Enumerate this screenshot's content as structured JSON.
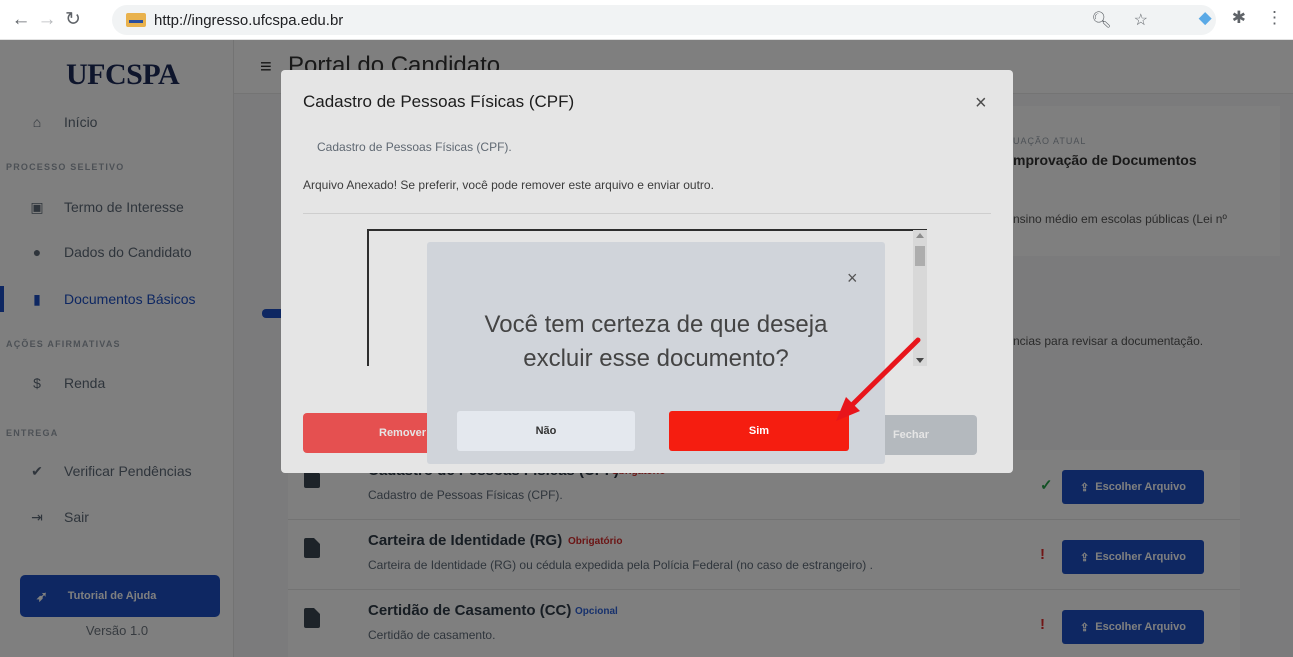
{
  "browser": {
    "url": "http://ingresso.ufcspa.edu.br"
  },
  "sidebar": {
    "logo": "UFCSPA",
    "items": [
      {
        "label": "Início",
        "icon": "home-icon"
      },
      {
        "label": "Termo de Interesse",
        "icon": "print-icon"
      },
      {
        "label": "Dados do Candidato",
        "icon": "user-icon"
      },
      {
        "label": "Documentos Básicos",
        "icon": "document-icon"
      },
      {
        "label": "Renda",
        "icon": "dollar-icon"
      },
      {
        "label": "Verificar Pendências",
        "icon": "check-icon"
      },
      {
        "label": "Sair",
        "icon": "logout-icon"
      }
    ],
    "sections": [
      "PROCESSO SELETIVO",
      "AÇÕES AFIRMATIVAS",
      "ENTREGA"
    ],
    "help_button": "Tutorial de Ajuda",
    "version": "Versão 1.0"
  },
  "header": {
    "title": "Portal do Candidato"
  },
  "status": {
    "label": "UAÇÃO ATUAL",
    "value": "mprovação de Documentos",
    "description": "nsino médio em escolas públicas (Lei nº",
    "review_note": "ncias para revisar a documentação."
  },
  "documents": [
    {
      "name": "Cadastro de Pessoas Físicas (CPF)",
      "tag": "Obrigatório",
      "desc": "Cadastro de Pessoas Físicas (CPF).",
      "status": "✓",
      "button": "Escolher Arquivo"
    },
    {
      "name": "Carteira de Identidade (RG)",
      "tag": "Obrigatório",
      "desc": "Carteira de Identidade (RG) ou cédula expedida pela Polícia Federal (no caso de estrangeiro) .",
      "status": "!",
      "button": "Escolher Arquivo"
    },
    {
      "name": "Certidão de Casamento (CC)",
      "tag": "Opcional",
      "desc": "Certidão de casamento.",
      "status": "!",
      "button": "Escolher Arquivo"
    }
  ],
  "modal": {
    "title": "Cadastro de Pessoas Físicas (CPF)",
    "subtitle": "Cadastro de Pessoas Físicas (CPF).",
    "note": "Arquivo Anexado! Se preferir, você pode remover este arquivo e enviar outro.",
    "remove_button": "Remover",
    "close_button": "Fechar"
  },
  "confirm": {
    "message_line1": "Você tem certeza de que deseja",
    "message_line2": "excluir esse documento?",
    "no_button": "Não",
    "yes_button": "Sim"
  },
  "colors": {
    "primary": "#1c4fc4",
    "danger": "#f51d10",
    "remove": "#ff5a5a",
    "annotation_arrow": "#e8151b"
  }
}
